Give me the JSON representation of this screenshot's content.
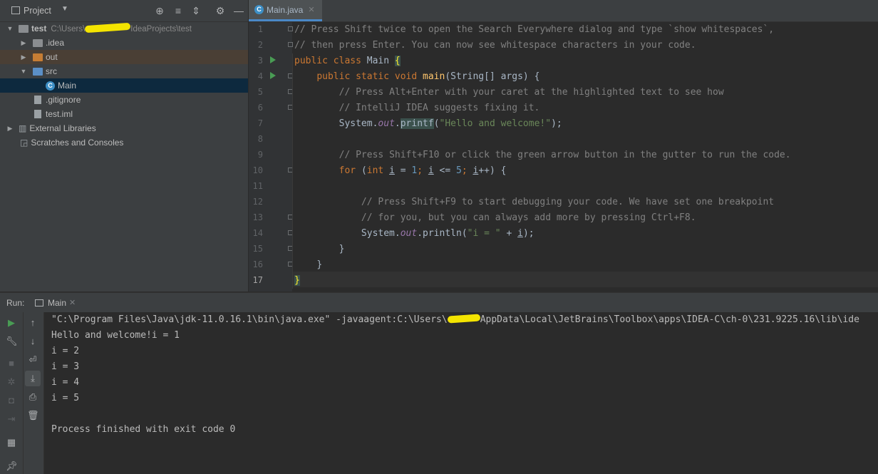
{
  "project_panel": {
    "title": "Project",
    "tree": [
      {
        "label": "test",
        "path_prefix": "C:\\Users\\",
        "path_suffix": "IdeaProjects\\test"
      },
      {
        "label": ".idea"
      },
      {
        "label": "out"
      },
      {
        "label": "src"
      },
      {
        "label": "Main"
      },
      {
        "label": ".gitignore"
      },
      {
        "label": "test.iml"
      },
      {
        "label": "External Libraries"
      },
      {
        "label": "Scratches and Consoles"
      }
    ]
  },
  "editor": {
    "tab_label": "Main.java",
    "line_numbers": [
      "1",
      "2",
      "3",
      "4",
      "5",
      "6",
      "7",
      "8",
      "9",
      "10",
      "11",
      "12",
      "13",
      "14",
      "15",
      "16",
      "17"
    ],
    "code": {
      "l1": "// Press Shift twice to open the Search Everywhere dialog and type `show whitespaces`,",
      "l2": "// then press Enter. You can now see whitespace characters in your code.",
      "l3_kw": "public class ",
      "l3_name": "Main ",
      "l3_brace": "{",
      "l4_kw": "public static void ",
      "l4_fn": "main",
      "l4_rest": "(String[] args) {",
      "l5": "// Press Alt+Enter with your caret at the highlighted text to see how",
      "l6": "// IntelliJ IDEA suggests fixing it.",
      "l7_a": "System.",
      "l7_out": "out",
      "l7_dot": ".",
      "l7_fn": "printf",
      "l7_p": "(",
      "l7_str": "\"Hello and welcome!\"",
      "l7_end": ");",
      "l9": "// Press Shift+F10 or click the green arrow button in the gutter to run the code.",
      "l10_for": "for ",
      "l10_p": "(",
      "l10_int": "int ",
      "l10_i": "i",
      "l10_eq": " = ",
      "l10_one": "1",
      "l10_semi1": "; ",
      "l10_i2": "i",
      "l10_le": " <= ",
      "l10_five": "5",
      "l10_semi2": "; ",
      "l10_i3": "i",
      "l10_end": "++) {",
      "l12": "// Press Shift+F9 to start debugging your code. We have set one breakpoint",
      "l13": "// for you, but you can always add more by pressing Ctrl+F8.",
      "l14_a": "System.",
      "l14_out": "out",
      "l14_b": ".println(",
      "l14_str": "\"i = \"",
      "l14_plus": " + ",
      "l14_i": "i",
      "l14_end": ");",
      "l15": "}",
      "l16": "}",
      "l17": "}"
    }
  },
  "run_panel": {
    "label": "Run:",
    "tab_label": "Main",
    "output": {
      "cmd_a": "\"C:\\Program Files\\Java\\jdk-11.0.16.1\\bin\\java.exe\" -javaagent:C:\\Users\\",
      "cmd_b": "AppData\\Local\\JetBrains\\Toolbox\\apps\\IDEA-C\\ch-0\\231.9225.16\\lib\\ide",
      "lines": [
        "Hello and welcome!i = 1",
        "i = 2",
        "i = 3",
        "i = 4",
        "i = 5",
        "",
        "Process finished with exit code 0"
      ]
    }
  },
  "colors": {
    "keyword": "#cc7832",
    "comment": "#808080",
    "string": "#6a8759",
    "number": "#6897bb",
    "field": "#9876aa",
    "function": "#ffc66d",
    "selection": "#0d293e"
  }
}
